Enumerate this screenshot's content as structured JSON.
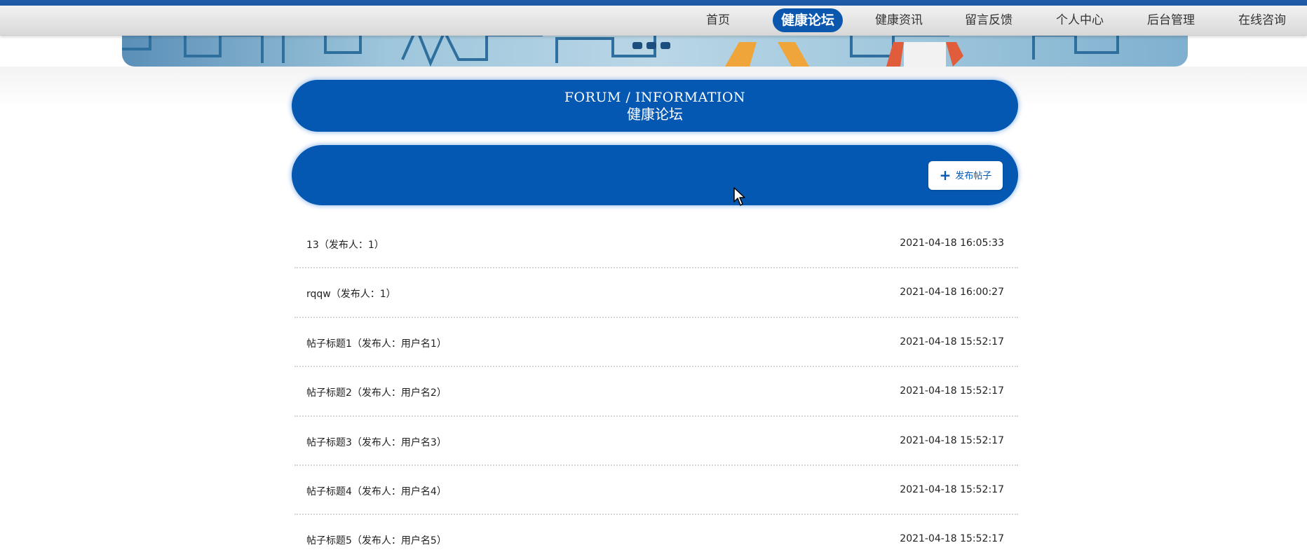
{
  "nav": {
    "items": [
      {
        "label": "首页",
        "active": false
      },
      {
        "label": "健康论坛",
        "active": true
      },
      {
        "label": "健康资讯",
        "active": false
      },
      {
        "label": "留言反馈",
        "active": false
      },
      {
        "label": "个人中心",
        "active": false
      },
      {
        "label": "后台管理",
        "active": false
      },
      {
        "label": "在线咨询",
        "active": false
      }
    ]
  },
  "forum": {
    "title_en": "FORUM / INFORMATION",
    "title_cn": "健康论坛",
    "post_button_label": "发布帖子",
    "post_button_icon": "plus-icon"
  },
  "posts": [
    {
      "title": "13（发布人：1）",
      "time": "2021-04-18 16:05:33"
    },
    {
      "title": "rqqw（发布人：1）",
      "time": "2021-04-18 16:00:27"
    },
    {
      "title": "帖子标题1（发布人：用户名1）",
      "time": "2021-04-18 15:52:17"
    },
    {
      "title": "帖子标题2（发布人：用户名2）",
      "time": "2021-04-18 15:52:17"
    },
    {
      "title": "帖子标题3（发布人：用户名3）",
      "time": "2021-04-18 15:52:17"
    },
    {
      "title": "帖子标题4（发布人：用户名4）",
      "time": "2021-04-18 15:52:17"
    },
    {
      "title": "帖子标题5（发布人：用户名5）",
      "time": "2021-04-18 15:52:17"
    }
  ],
  "colors": {
    "primary": "#0458b2",
    "nav_active": "#0b57ad",
    "text": "#222222"
  }
}
